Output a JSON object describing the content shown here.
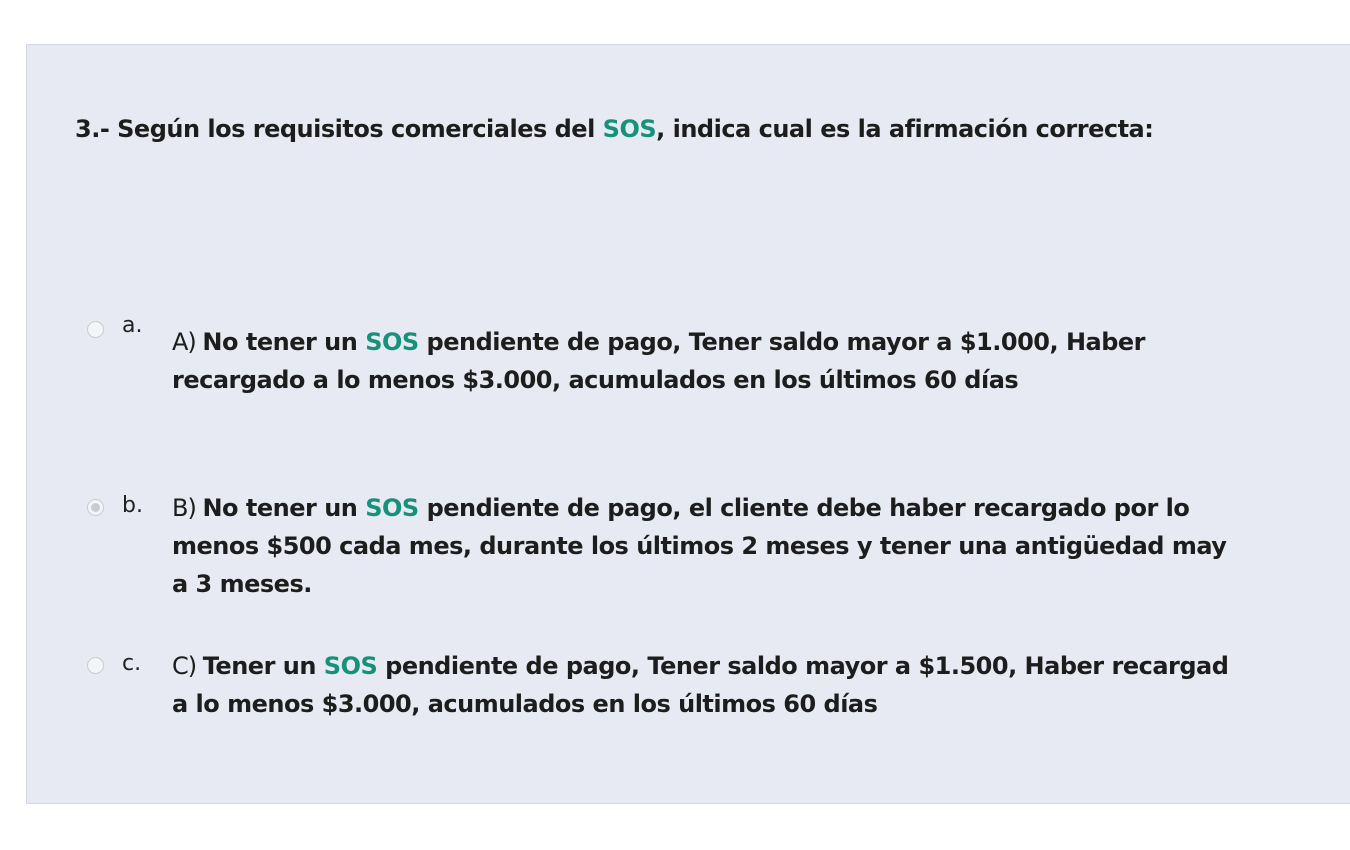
{
  "question": {
    "before": "3.- Según los requisitos comerciales del ",
    "highlight": "SOS",
    "after": ", indica cual es la afirmación correcta:"
  },
  "options": [
    {
      "letter": "a.",
      "checked": false,
      "prefix": "A) ",
      "bold1": "No tener un ",
      "highlight": "SOS",
      "line1_rest": " pendiente de pago, Tener saldo mayor a $1.000, Haber",
      "line2": "recargado a lo menos $3.000, acumulados en los últimos 60 días",
      "line3": ""
    },
    {
      "letter": "b.",
      "checked": true,
      "prefix": "B) ",
      "bold1": "No tener un ",
      "highlight": "SOS",
      "line1_rest": " pendiente de pago, el cliente debe haber recargado por lo",
      "line2": "menos $500 cada mes, durante los últimos 2 meses y tener una antigüedad may",
      "line3": "a 3 meses."
    },
    {
      "letter": "c.",
      "checked": false,
      "prefix": "C) ",
      "bold1": "Tener un ",
      "highlight": "SOS",
      "line1_rest": " pendiente de pago, Tener saldo mayor a $1.500, Haber recargad",
      "line2": "a lo menos $3.000, acumulados en los últimos 60 días",
      "line3": ""
    }
  ],
  "colors": {
    "panel_bg": "#e7eaf2",
    "highlight": "#16917c",
    "text": "#1d1d1d"
  }
}
